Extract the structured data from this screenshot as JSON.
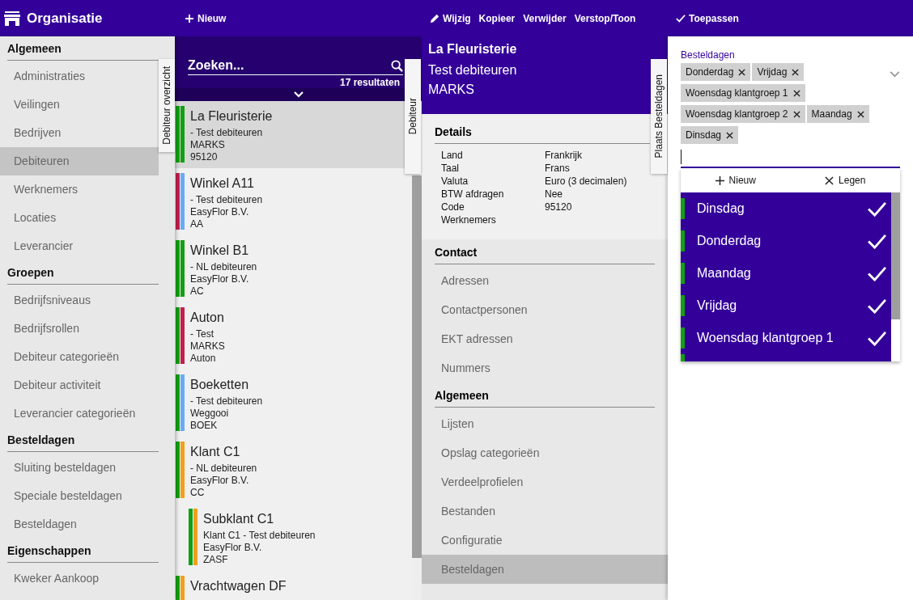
{
  "app": {
    "title": "Organisatie"
  },
  "toolbar": {
    "list_actions": [
      {
        "label": "Nieuw",
        "kind": "add"
      }
    ],
    "detail_actions": [
      {
        "label": "Wijzig",
        "kind": "edit"
      },
      {
        "label": "Kopieer",
        "kind": "text"
      },
      {
        "label": "Verwijder",
        "kind": "text"
      },
      {
        "label": "Verstop/Toon",
        "kind": "text"
      }
    ],
    "panel_actions": [
      {
        "label": "Toepassen",
        "kind": "apply"
      }
    ]
  },
  "sidebar": {
    "sections": [
      {
        "title": "Algemeen",
        "items": [
          {
            "label": "Administraties",
            "selected": false
          },
          {
            "label": "Veilingen",
            "selected": false
          },
          {
            "label": "Bedrijven",
            "selected": false
          },
          {
            "label": "Debiteuren",
            "selected": true
          },
          {
            "label": "Werknemers",
            "selected": false
          },
          {
            "label": "Locaties",
            "selected": false
          },
          {
            "label": "Leverancier",
            "selected": false
          }
        ]
      },
      {
        "title": "Groepen",
        "items": [
          {
            "label": "Bedrijfsniveaus",
            "selected": false
          },
          {
            "label": "Bedrijfsrollen",
            "selected": false
          },
          {
            "label": "Debiteur categorieën",
            "selected": false
          },
          {
            "label": "Debiteur activiteit",
            "selected": false
          },
          {
            "label": "Leverancier categorieën",
            "selected": false
          }
        ]
      },
      {
        "title": "Besteldagen",
        "items": [
          {
            "label": "Sluiting besteldagen",
            "selected": false
          },
          {
            "label": "Speciale besteldagen",
            "selected": false
          },
          {
            "label": "Besteldagen",
            "selected": false
          }
        ]
      },
      {
        "title": "Eigenschappen",
        "items": [
          {
            "label": "Kweker Aankoop",
            "selected": false
          }
        ]
      }
    ]
  },
  "side_tabs": [
    {
      "label": "Debiteur overzicht"
    },
    {
      "label": "Debiteur"
    },
    {
      "label": "Plaats Besteldagen"
    }
  ],
  "list": {
    "search": {
      "placeholder": "Zoeken..."
    },
    "result_count": "17 resultaten",
    "items": [
      {
        "title": "La Fleuristerie",
        "lines": [
          "- Test debiteuren",
          "MARKS",
          "95120"
        ],
        "bars": [
          {
            "color": "#12a012"
          },
          {
            "color": "#12a012"
          }
        ],
        "selected": true
      },
      {
        "title": "Winkel A11",
        "lines": [
          "- Test debiteuren",
          "EasyFlor B.V.",
          "AA"
        ],
        "bars": [
          {
            "color": "#c21f4b"
          },
          {
            "color": "#6aaaf5"
          }
        ],
        "selected": false
      },
      {
        "title": "Winkel B1",
        "lines": [
          "- NL debiteuren",
          "EasyFlor B.V.",
          "AC"
        ],
        "bars": [
          {
            "color": "#12a012"
          },
          {
            "color": "#12a012"
          }
        ],
        "selected": false
      },
      {
        "title": "Auton",
        "lines": [
          "- Test",
          "MARKS",
          "Auton"
        ],
        "bars": [
          {
            "color": "#12a012"
          },
          {
            "color": "#c21f4b"
          }
        ],
        "selected": false
      },
      {
        "title": "Boeketten",
        "lines": [
          "- Test debiteuren",
          "Weggooi",
          "BOEK"
        ],
        "bars": [
          {
            "color": "#12a012"
          },
          {
            "color": "#6aaaf5"
          }
        ],
        "selected": false
      },
      {
        "title": "Klant C1",
        "lines": [
          "- NL debiteuren",
          "EasyFlor B.V.",
          "CC"
        ],
        "bars": [
          {
            "color": "#12a012"
          },
          {
            "color": "#f0a01e"
          }
        ],
        "selected": false,
        "children": [
          {
            "title": "Subklant C1",
            "lines": [
              "Klant C1 - Test debiteuren",
              "EasyFlor B.V.",
              "ZASF"
            ],
            "bars": [
              {
                "color": "#12a012"
              },
              {
                "color": "#f0a01e"
              }
            ],
            "selected": false
          }
        ]
      },
      {
        "title": "Vrachtwagen DF",
        "bars": [
          {
            "color": "#12a012"
          },
          {
            "color": "#f0a01e"
          }
        ],
        "selected": false
      }
    ]
  },
  "detail": {
    "header": {
      "title": "La Fleuristerie",
      "lines": [
        "Test debiteuren",
        "MARKS"
      ]
    },
    "details": {
      "title": "Details",
      "fields": [
        {
          "label": "Land",
          "value": "Frankrijk"
        },
        {
          "label": "Taal",
          "value": "Frans"
        },
        {
          "label": "Valuta",
          "value": "Euro (3 decimalen)"
        },
        {
          "label": "BTW afdragen",
          "value": "Nee"
        },
        {
          "label": "Code",
          "value": "95120"
        },
        {
          "label": "Werknemers"
        }
      ]
    },
    "menu": [
      {
        "title": "Contact",
        "items": [
          {
            "label": "Adressen",
            "selected": false
          },
          {
            "label": "Contactpersonen",
            "selected": false
          },
          {
            "label": "EKT adressen",
            "selected": false
          },
          {
            "label": "Nummers",
            "selected": false
          }
        ]
      },
      {
        "title": "Algemeen",
        "items": [
          {
            "label": "Lijsten",
            "selected": false
          },
          {
            "label": "Opslag categorieën",
            "selected": false
          },
          {
            "label": "Verdeelprofielen",
            "selected": false
          },
          {
            "label": "Bestanden",
            "selected": false
          },
          {
            "label": "Configuratie",
            "selected": false
          },
          {
            "label": "Besteldagen",
            "selected": true
          }
        ]
      }
    ]
  },
  "panel": {
    "field": {
      "label": "Besteldagen",
      "chips": [
        "Donderdag",
        "Vrijdag",
        "Woensdag klantgroep 1",
        "Woensdag klantgroep 2",
        "Maandag",
        "Dinsdag"
      ]
    },
    "dropdown": {
      "actions": [
        {
          "label": "Nieuw",
          "kind": "add"
        },
        {
          "label": "Legen",
          "kind": "clear"
        }
      ],
      "options": [
        {
          "label": "Dinsdag",
          "checked": true
        },
        {
          "label": "Donderdag",
          "checked": true
        },
        {
          "label": "Maandag",
          "checked": true
        },
        {
          "label": "Vrijdag",
          "checked": true
        },
        {
          "label": "Woensdag klantgroep 1",
          "checked": true
        }
      ]
    }
  }
}
